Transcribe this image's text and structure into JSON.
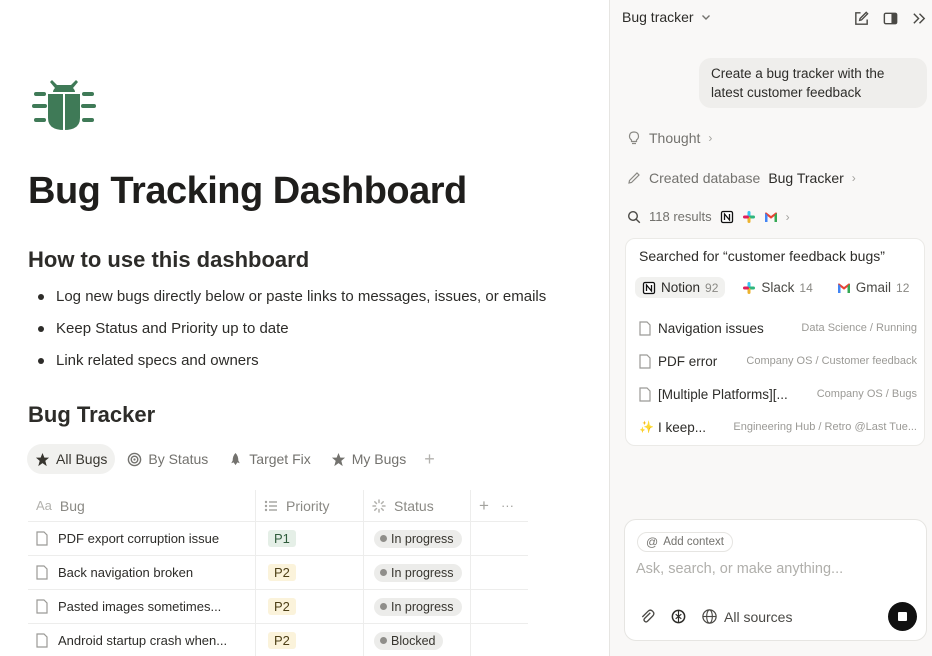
{
  "page": {
    "icon": "bug-icon",
    "title": "Bug Tracking Dashboard",
    "how_heading": "How to use this dashboard",
    "bullets": [
      "Log new bugs directly below or paste links to messages, issues, or emails",
      "Keep Status and Priority up to date",
      "Link related specs and owners"
    ],
    "tracker_heading": "Bug Tracker",
    "views": [
      {
        "label": "All Bugs",
        "icon": "star-icon",
        "active": true
      },
      {
        "label": "By Status",
        "icon": "target-icon",
        "active": false
      },
      {
        "label": "Target Fix",
        "icon": "rocket-icon",
        "active": false
      },
      {
        "label": "My Bugs",
        "icon": "star-icon",
        "active": false
      }
    ],
    "view_add": "+",
    "table": {
      "columns": [
        {
          "label": "Bug",
          "icon": "text-icon"
        },
        {
          "label": "Priority",
          "icon": "list-icon"
        },
        {
          "label": "Status",
          "icon": "spinner-icon"
        }
      ],
      "add": "+",
      "more": "···",
      "rows": [
        {
          "bug": "PDF export corruption issue",
          "priority": "P1",
          "status": "In progress"
        },
        {
          "bug": "Back navigation broken",
          "priority": "P2",
          "status": "In progress"
        },
        {
          "bug": "Pasted images sometimes...",
          "priority": "P2",
          "status": "In progress"
        },
        {
          "bug": "Android startup crash when...",
          "priority": "P2",
          "status": "Blocked"
        }
      ]
    }
  },
  "panel": {
    "title": "Bug tracker",
    "user_message": "Create a bug tracker with the latest customer feedback",
    "thought": "Thought",
    "created_prefix": "Created database",
    "created_name": "Bug Tracker",
    "results_count": "118 results",
    "search_title": "Searched for “customer feedback bugs”",
    "sources": [
      {
        "name": "Notion",
        "count": "92",
        "icon": "notion-icon",
        "active": true
      },
      {
        "name": "Slack",
        "count": "14",
        "icon": "slack-icon",
        "active": false
      },
      {
        "name": "Gmail",
        "count": "12",
        "icon": "gmail-icon",
        "active": false
      }
    ],
    "results": [
      {
        "title": "Navigation issues",
        "path": "Data Science / Running",
        "icon": "page-icon"
      },
      {
        "title": "PDF error",
        "path": "Company OS / Customer feedback",
        "icon": "page-icon"
      },
      {
        "title": "[Multiple Platforms][...",
        "path": "Company OS / Bugs",
        "icon": "page-icon"
      },
      {
        "title": "I keep...",
        "path": "Engineering Hub / Retro @Last Tue...",
        "icon": "sparkles-icon"
      }
    ],
    "composer": {
      "add_context": "Add context",
      "placeholder": "Ask, search, or make anything...",
      "all_sources": "All sources"
    }
  },
  "colors": {
    "bug_icon": "#3f7a57",
    "p1_bg": "#e5efe7",
    "p2_bg": "#fbf3db",
    "status_bg": "#ececea"
  }
}
